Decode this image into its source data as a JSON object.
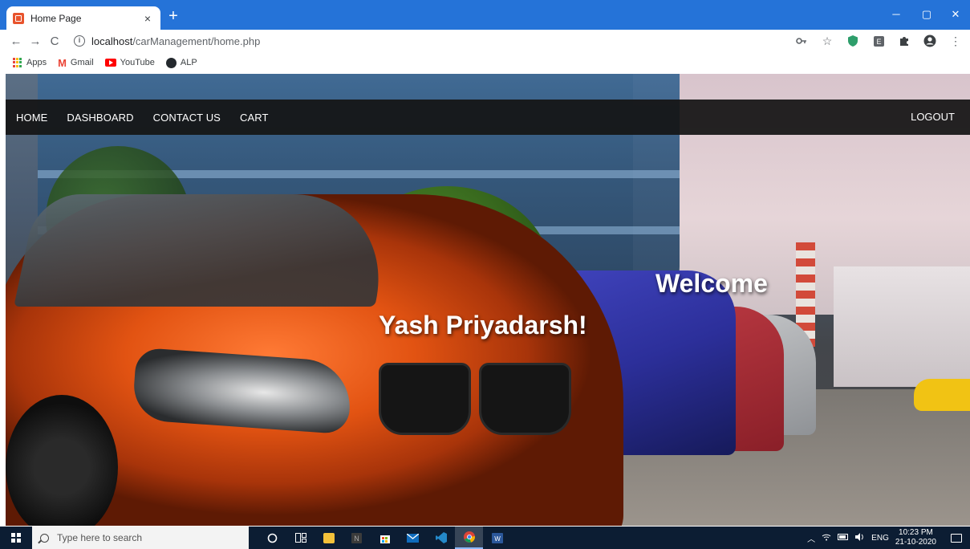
{
  "browser": {
    "tab_title": "Home Page",
    "tab_close": "×",
    "new_tab": "+",
    "window_controls": {
      "minimize": "─",
      "maximize": "▢",
      "close": "✕"
    },
    "nav": {
      "back": "←",
      "forward": "→",
      "reload": "C"
    },
    "url_host": "localhost",
    "url_path": "/carManagement/home.php",
    "bookmarks": [
      "Apps",
      "Gmail",
      "YouTube",
      "ALP"
    ]
  },
  "navbar": {
    "items": [
      "HOME",
      "DASHBOARD",
      "CONTACT US",
      "CART"
    ],
    "logout": "LOGOUT"
  },
  "hero": {
    "welcome": "Welcome",
    "username": "Yash Priyadarsh!"
  },
  "taskbar": {
    "search_placeholder": "Type here to search",
    "language": "ENG",
    "time": "10:23 PM",
    "date": "21-10-2020"
  },
  "colors": {
    "chrome_bar": "#2573d8",
    "navbar_bg": "#141414",
    "taskbar_bg": "#0c1d33"
  }
}
